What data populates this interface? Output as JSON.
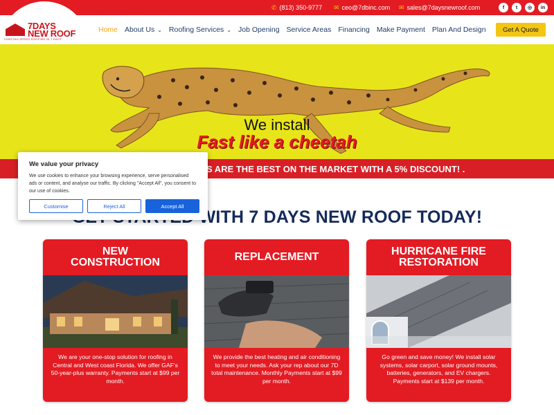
{
  "topbar": {
    "phone": "(813) 350-9777",
    "email1": "ceo@7dbinc.com",
    "email2": "sales@7daysnewroof.com",
    "socials": [
      "facebook-icon",
      "twitter-icon",
      "instagram-icon",
      "linkedin-icon"
    ]
  },
  "logo": {
    "line1": "7DAYS",
    "line2": "NEW ROOF",
    "tagline": "CHEETAH SPEED ROOFING IN 7 DAYS"
  },
  "nav": {
    "items": [
      {
        "label": "Home"
      },
      {
        "label": "About Us"
      },
      {
        "label": "Roofing Services"
      },
      {
        "label": "Job Opening"
      },
      {
        "label": "Service Areas"
      },
      {
        "label": "Financing"
      },
      {
        "label": "Make Payment"
      },
      {
        "label": "Plan And Design"
      }
    ],
    "cta": "Get A Quote"
  },
  "hero": {
    "line1": "We install",
    "line2": "Fast like a cheetah"
  },
  "promo": "S ARE THE BEST ON THE MARKET WITH A 5% DISCOUNT! .",
  "headline": "GET STARTED WITH 7 DAYS NEW ROOF TODAY!",
  "cards": [
    {
      "title_l1": "NEW",
      "title_l2": "CONSTRUCTION",
      "text": "We are your one-stop solution for roofing in Central and West coast Florida. We offer GAF's 50-year-plus warranty. Payments start at $99 per month."
    },
    {
      "title_l1": "REPLACEMENT",
      "title_l2": "",
      "text": "We provide the best heating and air conditioning to meet your needs. Ask your rep about our 7D total maintenance. Monthly Payments start at $99 per month."
    },
    {
      "title_l1": "HURRICANE FIRE",
      "title_l2": "RESTORATION",
      "text": "Go green and save money! We install solar systems, solar carport, solar ground mounts, batteries, generators, and EV chargers. Payments start at $139 per month."
    }
  ],
  "cookie": {
    "title": "We value your privacy",
    "text": "We use cookies to enhance your browsing experience, serve personalised ads or content, and analyse our traffic. By clicking \"Accept All\", you consent to our use of cookies.",
    "customise": "Customise",
    "reject": "Reject All",
    "accept": "Accept All"
  },
  "colors": {
    "brand_red": "#e31b23",
    "hero_yellow": "#e7e41a",
    "navy": "#142a5a",
    "cta_yellow": "#f3c614",
    "cookie_blue": "#1863dc"
  }
}
